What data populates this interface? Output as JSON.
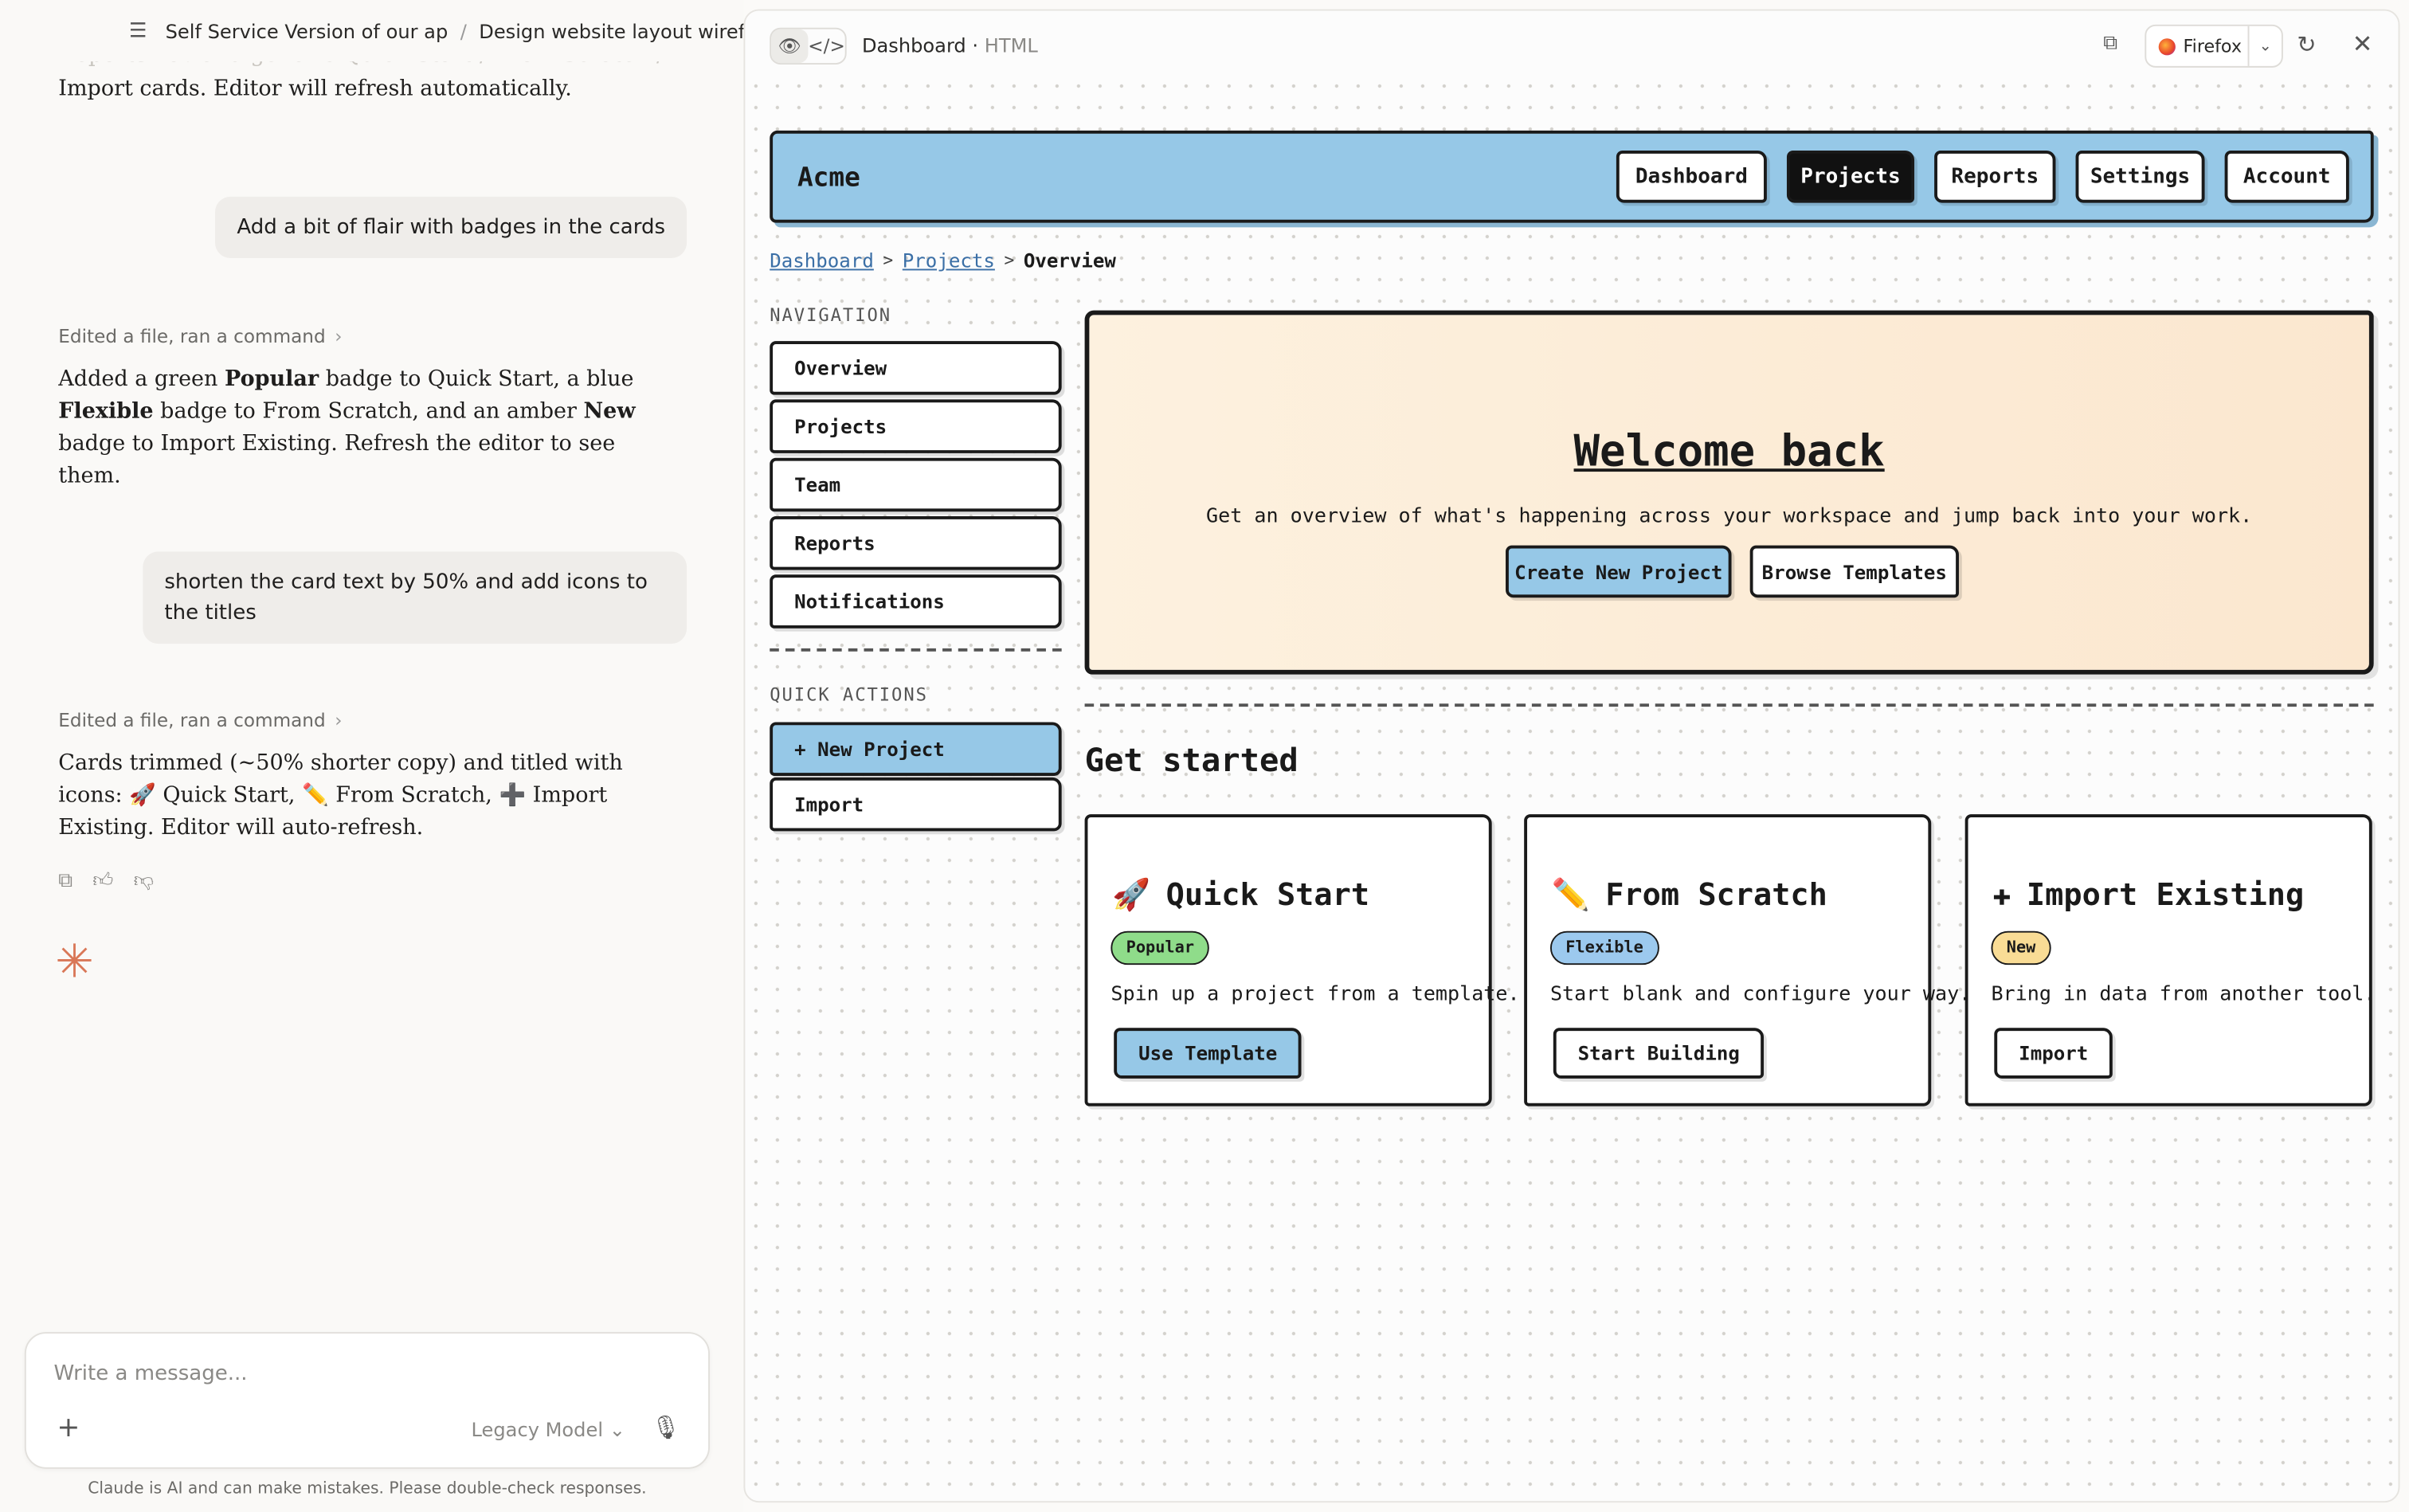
{
  "chat": {
    "breadcrumb": {
      "project": "Self Service Version of our ap",
      "separator": "/",
      "page": "Design website layout wireframe"
    },
    "faded_line": "Reports nav and generic Quick Start / From Scratch /",
    "intro_line": "Import cards. Editor will refresh automatically.",
    "user_msg_1": "Add a bit of flair with badges in the cards",
    "meta_1": "Edited a file, ran a command",
    "reply_1": {
      "p1": "Added a green ",
      "b1": "Popular",
      "p2": " badge to Quick Start, a blue ",
      "b2": "Flexible",
      "p3": " badge to From Scratch, and an amber ",
      "b3": "New",
      "p4": " badge to Import Existing. Refresh the editor to see them."
    },
    "user_msg_2": "shorten the card text by 50% and add icons to the titles",
    "meta_2": "Edited a file, ran a command",
    "reply_2": "Cards trimmed (~50% shorter copy) and titled with icons: 🚀 Quick Start, ✏️ From Scratch, ➕ Import Existing. Editor will auto-refresh.",
    "composer_placeholder": "Write a message...",
    "model_label": "Legacy Model",
    "disclaimer": "Claude is AI and can make mistakes. Please double-check responses."
  },
  "preview": {
    "title": "Dashboard",
    "subtitle": "HTML",
    "browser": "Firefox"
  },
  "site": {
    "brand": "Acme",
    "nav": [
      {
        "label": "Dashboard",
        "active": false
      },
      {
        "label": "Projects",
        "active": true
      },
      {
        "label": "Reports",
        "active": false
      },
      {
        "label": "Settings",
        "active": false
      },
      {
        "label": "Account",
        "active": false
      }
    ],
    "breadcrumbs": {
      "first": "Dashboard",
      "second": "Projects",
      "current": "Overview"
    },
    "sidebar": {
      "nav_label": "NAVIGATION",
      "nav_items": [
        "Overview",
        "Projects",
        "Team",
        "Reports",
        "Notifications"
      ],
      "actions_label": "QUICK ACTIONS",
      "actions": [
        "+ New Project",
        "Import"
      ]
    },
    "hero": {
      "title": "Welcome back",
      "text": "Get an overview of what's happening across your workspace and jump back into your work.",
      "primary": "Create New Project",
      "secondary": "Browse Templates"
    },
    "section_title": "Get started",
    "cards": [
      {
        "icon": "🚀",
        "title": "Quick Start",
        "badge": "Popular",
        "badge_color": "#8fdc8a",
        "text": "Spin up a project from a template.",
        "button": "Use Template"
      },
      {
        "icon": "✏️",
        "title": "From Scratch",
        "badge": "Flexible",
        "badge_color": "#9cc9ee",
        "text": "Start blank and configure your way.",
        "button": "Start Building"
      },
      {
        "icon": "✚",
        "title": "Import Existing",
        "badge": "New",
        "badge_color": "#f9dc95",
        "text": "Bring in data from another tool.",
        "button": "Import"
      }
    ]
  }
}
